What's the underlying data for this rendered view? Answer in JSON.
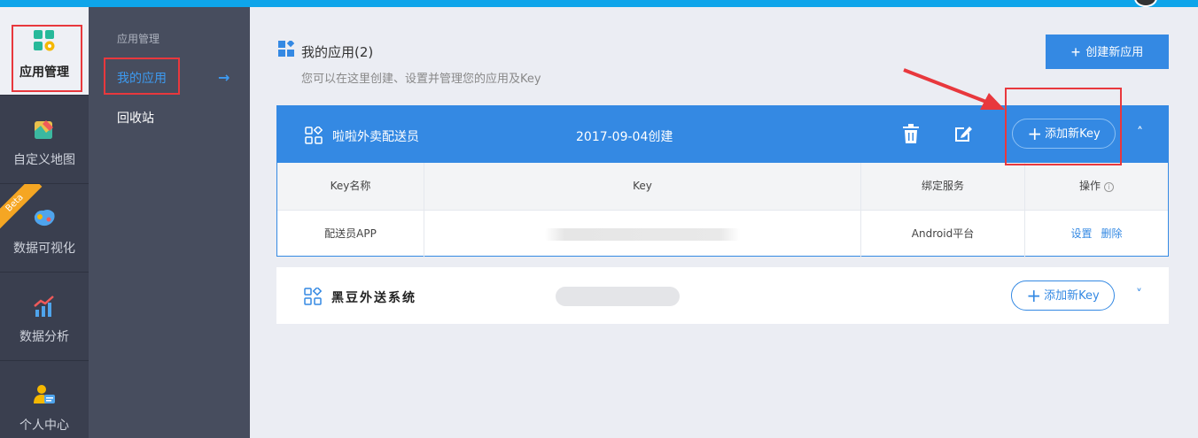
{
  "colors": {
    "accent": "#3489e3",
    "sidebar": "#3a3f4f",
    "annotation": "#e8383d"
  },
  "nav_primary": [
    {
      "label": "应用管理",
      "icon": "apps-gear-icon"
    },
    {
      "label": "自定义地图",
      "icon": "map-edit-icon"
    },
    {
      "label": "数据可视化",
      "icon": "china-map-icon",
      "badge": "Beta"
    },
    {
      "label": "数据分析",
      "icon": "chart-trend-icon"
    },
    {
      "label": "个人中心",
      "icon": "user-card-icon"
    }
  ],
  "nav_secondary": {
    "group": "应用管理",
    "items": [
      {
        "label": "我的应用"
      },
      {
        "label": "回收站"
      }
    ],
    "arrow": "→"
  },
  "header": {
    "title": "我的应用(2)",
    "subtitle": "您可以在这里创建、设置并管理您的应用及Key",
    "create_button": "创建新应用"
  },
  "apps": [
    {
      "name": "啦啦外卖配送员",
      "created": "2017-09-04创建",
      "add_key": "添加新Key",
      "chevron": "˄",
      "table": {
        "headers": [
          "Key名称",
          "Key",
          "绑定服务",
          "操作"
        ],
        "rows": [
          {
            "name": "配送员APP",
            "service": "Android平台",
            "actions": [
              "设置",
              "删除"
            ]
          }
        ]
      }
    },
    {
      "name": "黑豆外送系统",
      "add_key": "添加新Key",
      "chevron": "˅"
    }
  ],
  "symbols": {
    "plus": "+",
    "info": "i"
  }
}
